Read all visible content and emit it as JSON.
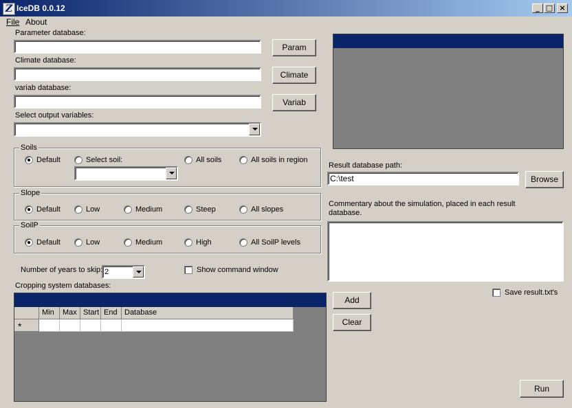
{
  "window": {
    "title": "IceDB 0.0.12",
    "icon_letter": "Z",
    "min": "_",
    "max": "□",
    "close": "×"
  },
  "menu": {
    "file": "File",
    "about": "About"
  },
  "param": {
    "label": "Parameter database:",
    "value": "",
    "button": "Param"
  },
  "climate": {
    "label": "Climate database:",
    "value": "",
    "button": "Climate"
  },
  "variab": {
    "label": "variab database:",
    "value": "",
    "button": "Variab"
  },
  "output": {
    "label": "Select output variables:",
    "value": ""
  },
  "soils": {
    "title": "Soils",
    "options": [
      "Default",
      "Select soil:",
      "All soils",
      "All soils in region"
    ],
    "selected": 0
  },
  "slope": {
    "title": "Slope",
    "options": [
      "Default",
      "Low",
      "Medium",
      "Steep",
      "All slopes"
    ],
    "selected": 0
  },
  "soilp": {
    "title": "SoilP",
    "options": [
      "Default",
      "Low",
      "Medium",
      "High",
      "All SoilP levels"
    ],
    "selected": 0
  },
  "years": {
    "label": "Number of years to skip:",
    "value": "2"
  },
  "show_cmd": {
    "label": "Show command window",
    "checked": false
  },
  "cropping": {
    "label": "Cropping system databases:",
    "columns": [
      "Min",
      "Max",
      "Start",
      "End",
      "Database"
    ],
    "new_row_marker": "*"
  },
  "result": {
    "label": "Result database path:",
    "value": "C:\\test",
    "browse": "Browse"
  },
  "commentary": {
    "label_line1": "Commentary about the simulation, placed in each result",
    "label_line2": "database.",
    "value": ""
  },
  "save_result": {
    "label": "Save result.txt's",
    "checked": false
  },
  "buttons": {
    "add": "Add",
    "clear": "Clear",
    "run": "Run"
  },
  "colors": {
    "navy": "#0a246a",
    "dark_panel": "#808080",
    "face": "#d4d0c8"
  }
}
